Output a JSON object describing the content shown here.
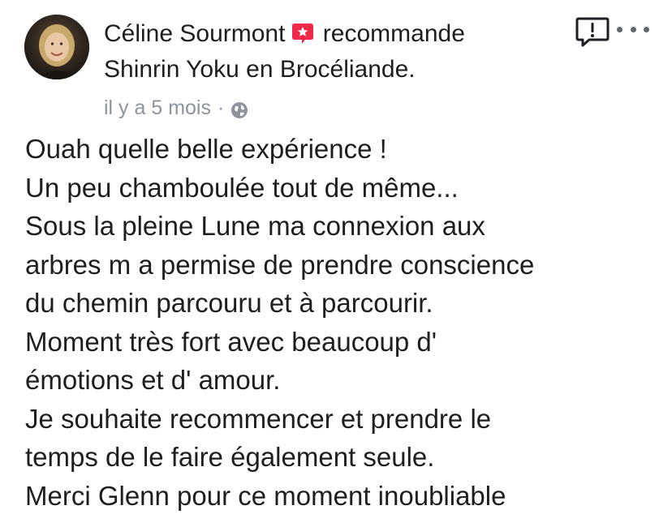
{
  "post": {
    "author": "Céline Sourmont",
    "action": "recommande",
    "page_name": "Shinrin Yoku en Brocéliande.",
    "timestamp": "il y a 5 mois",
    "separator": "·",
    "privacy_icon": "globe-icon",
    "recommend_icon": "recommend-star-icon",
    "report_icon": "report-exclamation-icon",
    "more_icon": "more-dots-icon",
    "body_lines": [
      "Ouah quelle belle expérience !",
      "Un peu chamboulée tout de même...",
      "Sous la pleine Lune ma connexion aux",
      "arbres m a permise de prendre conscience",
      "du chemin parcouru et à parcourir.",
      "Moment très fort avec beaucoup d'",
      "émotions et d' amour.",
      "Je souhaite recommencer et prendre le",
      "temps de le faire également seule.",
      "Merci Glenn pour ce moment inoubliable"
    ]
  },
  "colors": {
    "recommend_red": "#f0284a",
    "meta_gray": "#8d949e",
    "text": "#1c1e21",
    "icon_dark": "#1c1e21"
  }
}
